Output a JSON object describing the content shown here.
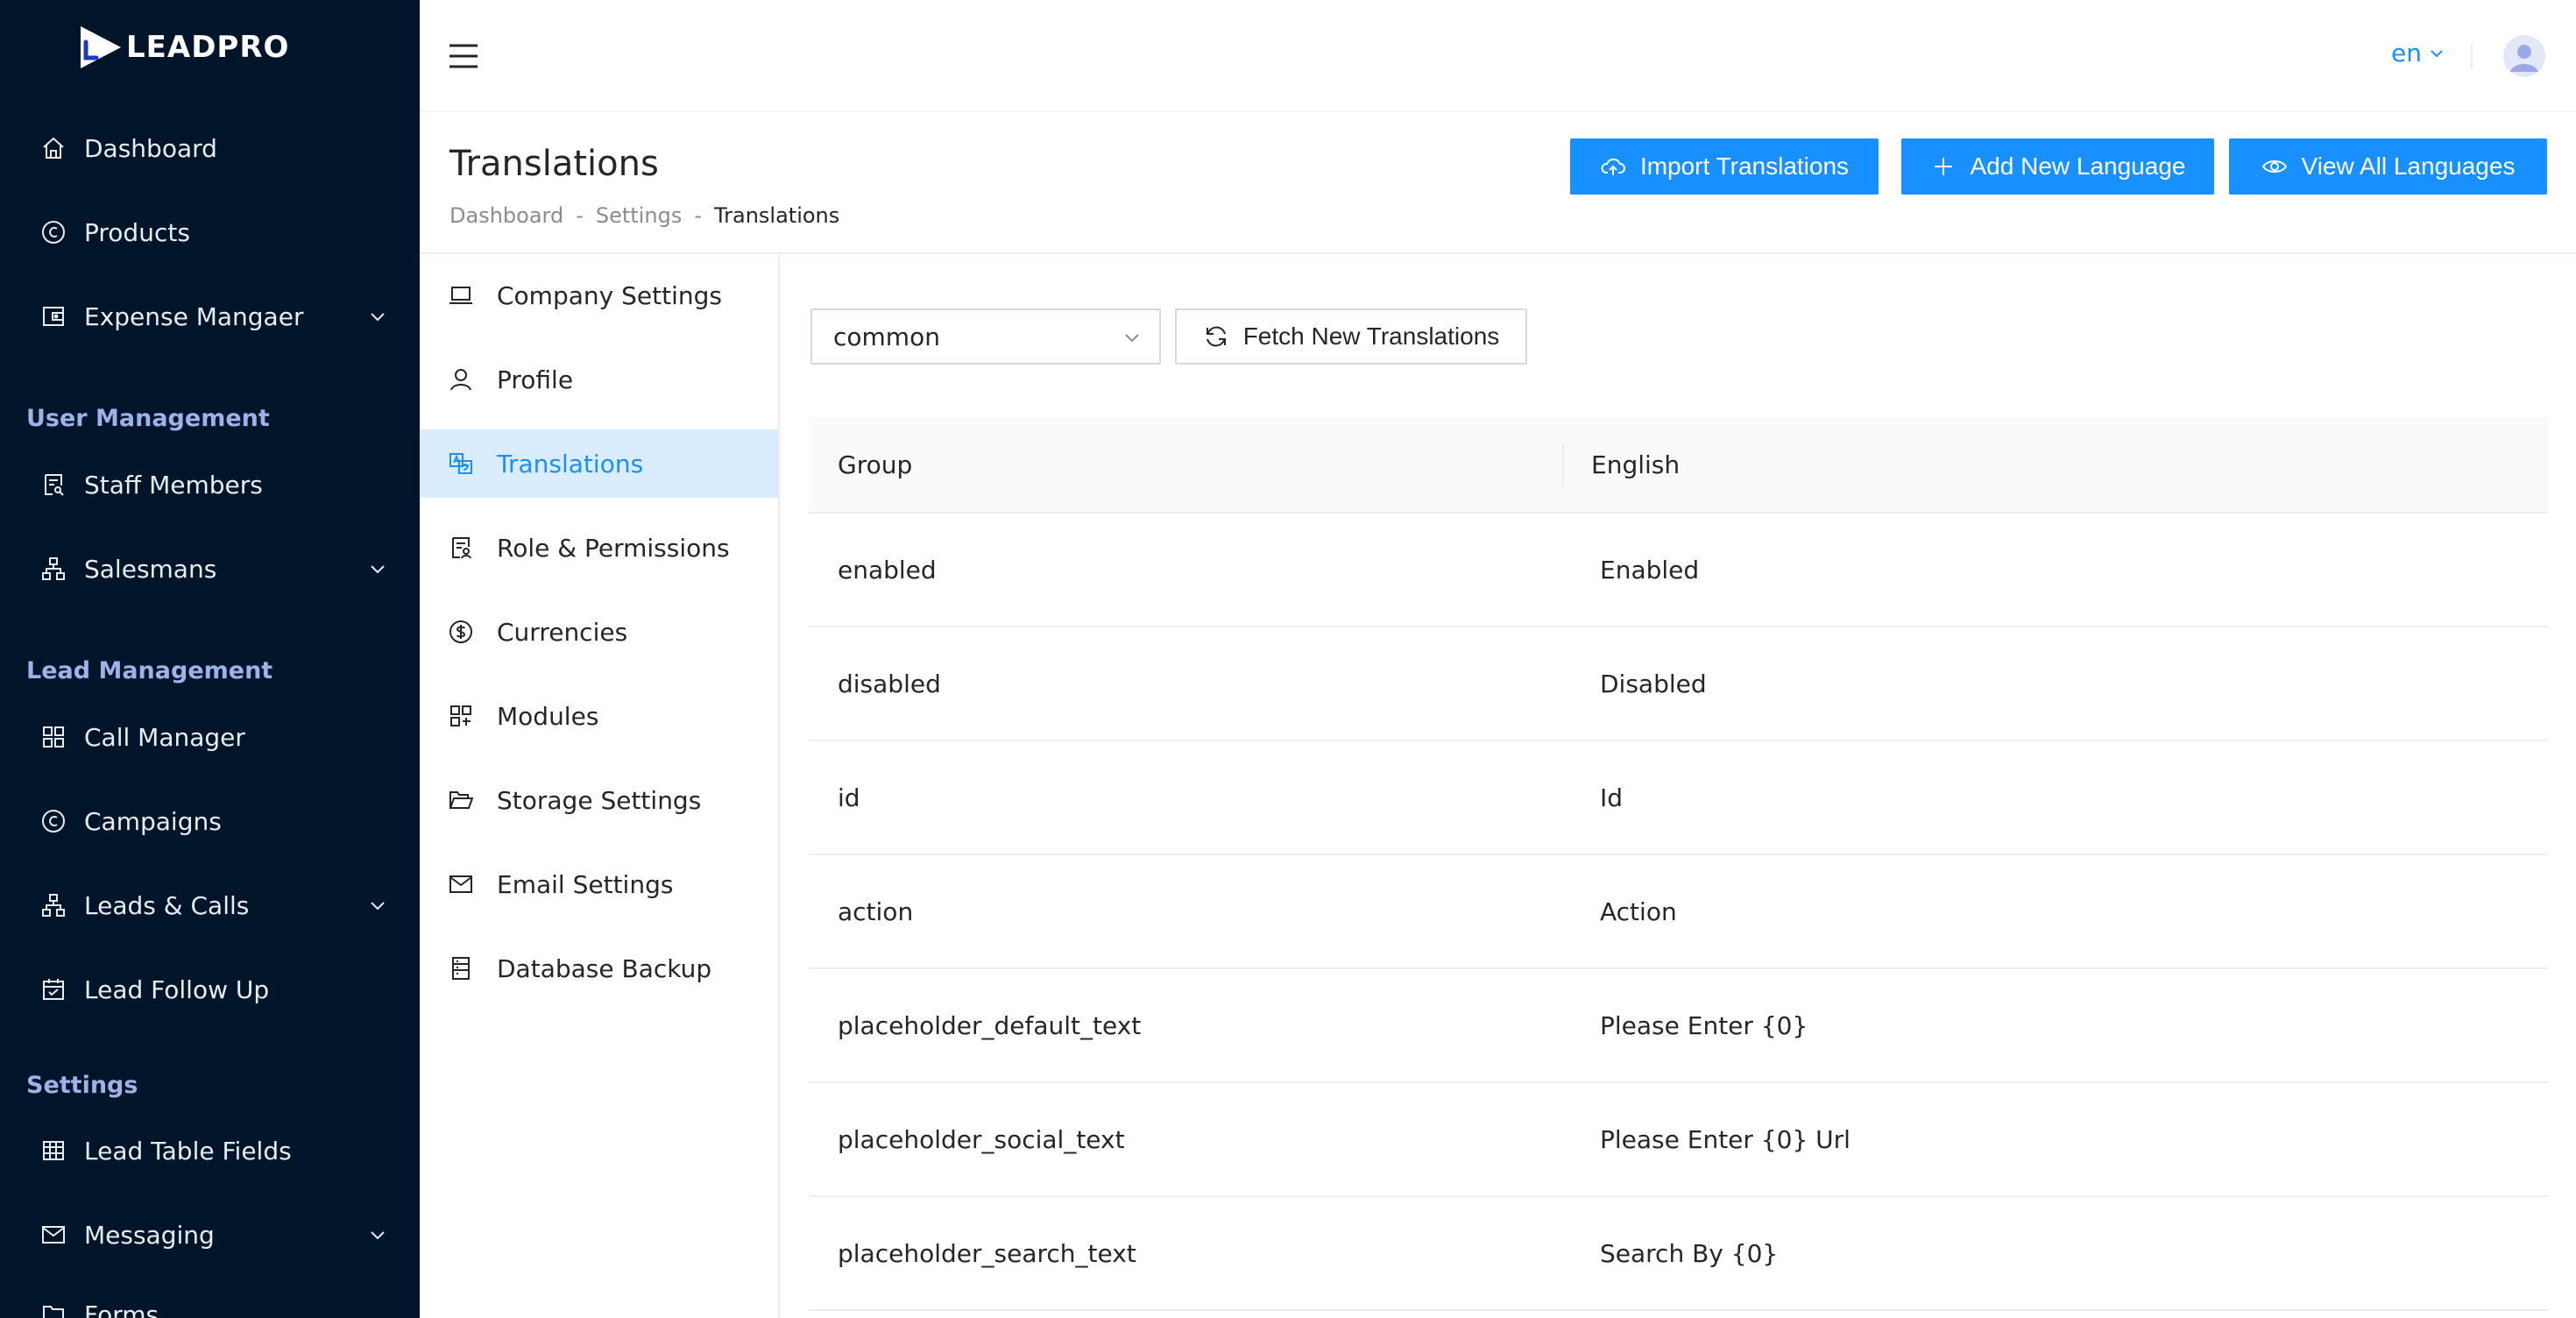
{
  "brand": {
    "name": "LEADPRO"
  },
  "sidebar": {
    "items": [
      {
        "label": "Dashboard",
        "icon": "home-icon"
      },
      {
        "label": "Products",
        "icon": "copyright-icon"
      },
      {
        "label": "Expense Mangaer",
        "icon": "wallet-icon",
        "expandable": true
      },
      {
        "label": "Staff Members",
        "icon": "contacts-icon"
      },
      {
        "label": "Salesmans",
        "icon": "cluster-icon",
        "expandable": true
      },
      {
        "label": "Call Manager",
        "icon": "apps-icon"
      },
      {
        "label": "Campaigns",
        "icon": "copyright-icon"
      },
      {
        "label": "Leads & Calls",
        "icon": "cluster-icon",
        "expandable": true
      },
      {
        "label": "Lead Follow Up",
        "icon": "calendar-icon"
      },
      {
        "label": "Lead Table Fields",
        "icon": "table-icon"
      },
      {
        "label": "Messaging",
        "icon": "mail-icon",
        "expandable": true
      },
      {
        "label": "Forms",
        "icon": "form-icon"
      }
    ],
    "groups": {
      "user_management": "User Management",
      "lead_management": "Lead Management",
      "settings": "Settings"
    }
  },
  "header": {
    "language": "en",
    "avatar_icon": "user-avatar-icon"
  },
  "page": {
    "title": "Translations",
    "breadcrumb": [
      "Dashboard",
      "Settings",
      "Translations"
    ],
    "breadcrumb_separator": "-",
    "actions": {
      "import": "Import Translations",
      "add_language": "Add New Language",
      "view_languages": "View All Languages"
    }
  },
  "settings_menu": {
    "active": "Translations",
    "items": [
      {
        "label": "Company Settings",
        "icon": "laptop-icon"
      },
      {
        "label": "Profile",
        "icon": "user-icon"
      },
      {
        "label": "Translations",
        "icon": "translation-icon"
      },
      {
        "label": "Role & Permissions",
        "icon": "solution-icon"
      },
      {
        "label": "Currencies",
        "icon": "dollar-icon"
      },
      {
        "label": "Modules",
        "icon": "appstore-add-icon"
      },
      {
        "label": "Storage Settings",
        "icon": "folder-open-icon"
      },
      {
        "label": "Email Settings",
        "icon": "mail-icon"
      },
      {
        "label": "Database Backup",
        "icon": "database-icon"
      }
    ]
  },
  "translations": {
    "group_select": {
      "value": "common"
    },
    "fetch_button": "Fetch New Translations",
    "columns": [
      "Group",
      "English"
    ],
    "rows": [
      {
        "key": "enabled",
        "value": "Enabled"
      },
      {
        "key": "disabled",
        "value": "Disabled"
      },
      {
        "key": "id",
        "value": "Id"
      },
      {
        "key": "action",
        "value": "Action"
      },
      {
        "key": "placeholder_default_text",
        "value": "Please Enter {0}"
      },
      {
        "key": "placeholder_social_text",
        "value": "Please Enter {0} Url"
      },
      {
        "key": "placeholder_search_text",
        "value": "Search By {0}"
      }
    ]
  },
  "colors": {
    "sidebar_bg": "#001529",
    "primary": "#1890ff",
    "group_label": "#9db2e8",
    "active_menu_bg": "#d9edfe"
  }
}
